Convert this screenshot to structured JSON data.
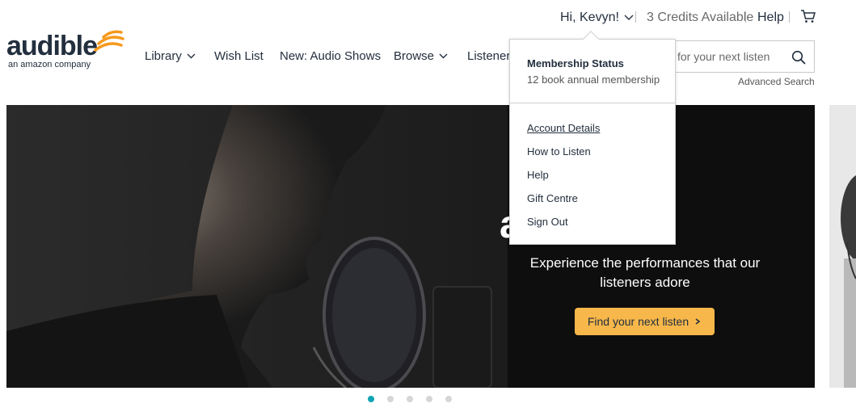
{
  "utility": {
    "greeting": "Hi, Kevyn!",
    "credits": "3 Credits Available",
    "help": "Help"
  },
  "logo": {
    "wordmark": "audible",
    "tagline": "an amazon company"
  },
  "nav": {
    "items": [
      {
        "label": "Library",
        "has_dropdown": true
      },
      {
        "label": "Wish List",
        "has_dropdown": false
      },
      {
        "label": "New: Audio Shows",
        "has_dropdown": false
      },
      {
        "label": "Browse",
        "has_dropdown": true
      },
      {
        "label": "Listener",
        "has_dropdown": false
      }
    ]
  },
  "search": {
    "placeholder": "for your next listen",
    "advanced": "Advanced Search"
  },
  "hero": {
    "headline_line1": "r",
    "headline_line2": "ances",
    "subtitle": "Experience the performances that our listeners adore",
    "cta": "Find your next listen"
  },
  "carousel": {
    "dot_count": 5,
    "active_index": 0
  },
  "dropdown": {
    "status_title": "Membership Status",
    "status_value": "12 book annual membership",
    "items": [
      "Account Details",
      "How to Listen",
      "Help",
      "Gift Centre",
      "Sign Out"
    ]
  },
  "colors": {
    "accent": "#f7b74a",
    "logo_orange": "#f7991c",
    "active_dot": "#11a3b5",
    "text": "#232f3e"
  },
  "icons": [
    "chevron-down-icon",
    "cart-icon",
    "search-icon",
    "chevron-right-icon",
    "audible-waves-icon"
  ]
}
